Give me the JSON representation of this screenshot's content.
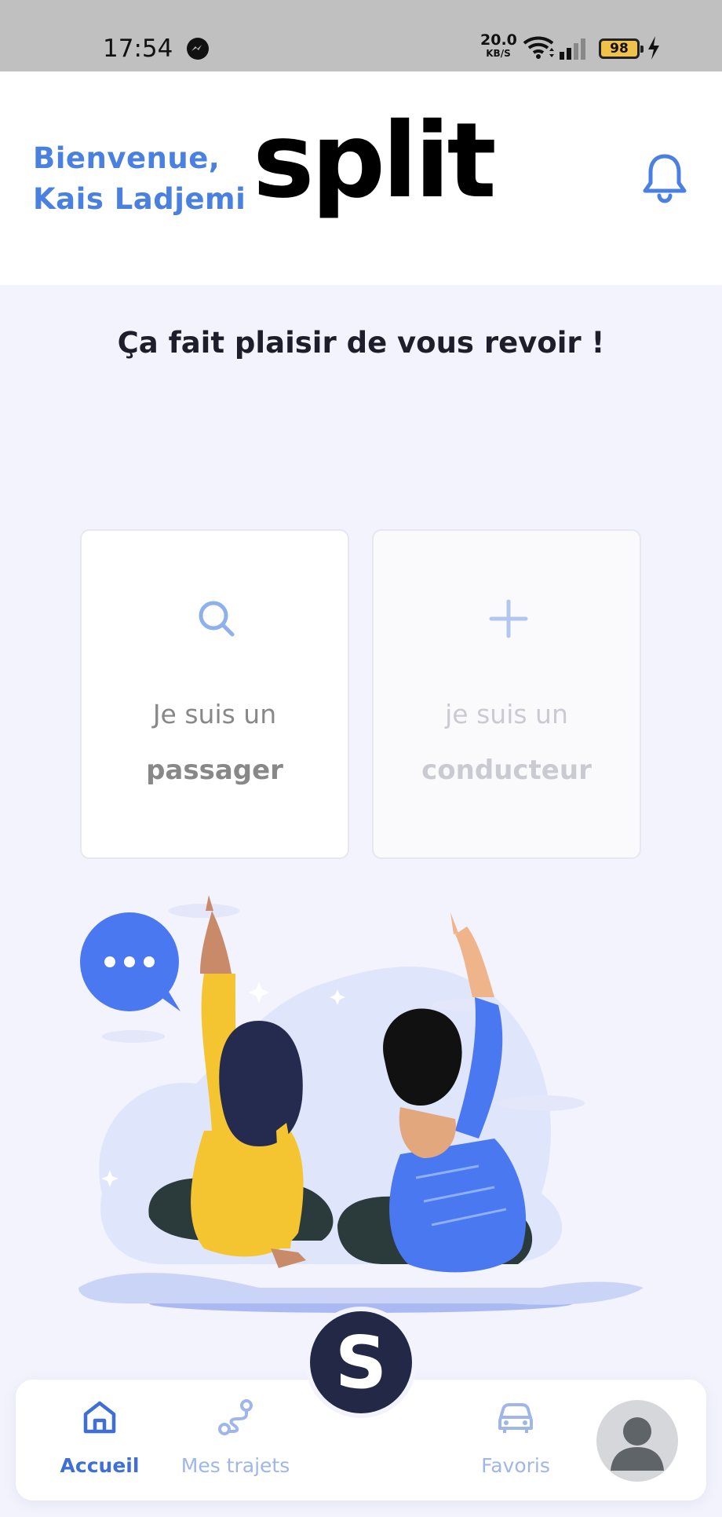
{
  "status_bar": {
    "time": "17:54",
    "net_speed_value": "20.0",
    "net_speed_unit": "KB/S",
    "battery": "98"
  },
  "header": {
    "welcome_line1": "Bienvenue,",
    "welcome_line2": "Kais Ladjemi",
    "logo_text": "split",
    "icons": {
      "notification": "bell-icon"
    }
  },
  "main": {
    "greeting": "Ça fait plaisir de vous revoir !",
    "cards": [
      {
        "icon": "search-icon",
        "line1": "Je suis un",
        "line2": "passager"
      },
      {
        "icon": "plus-icon",
        "line1": "je suis un",
        "line2": "conducteur"
      }
    ]
  },
  "bottom_nav": {
    "items": [
      {
        "label": "Accueil",
        "icon": "home-icon",
        "active": true
      },
      {
        "label": "Mes trajets",
        "icon": "route-icon",
        "active": false
      },
      {
        "label": "Favoris",
        "icon": "car-icon",
        "active": false
      }
    ],
    "center_button": "S",
    "profile_icon": "avatar-icon"
  },
  "colors": {
    "accent": "#4a80e0",
    "nav_active": "#3f6fd6",
    "nav_inactive": "#9fb6ea",
    "background": "#f2f3fc",
    "fab": "#232847"
  }
}
